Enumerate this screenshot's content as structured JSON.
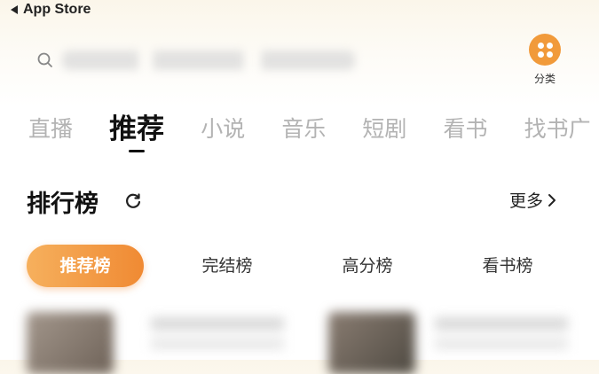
{
  "status_bar": {
    "back_label": "App Store"
  },
  "search": {
    "placeholder": ""
  },
  "category_button": {
    "label": "分类",
    "icon": "four-dots-icon",
    "color": "#f19a3a"
  },
  "tabs": [
    {
      "label": "直播",
      "active": false
    },
    {
      "label": "推荐",
      "active": true
    },
    {
      "label": "小说",
      "active": false
    },
    {
      "label": "音乐",
      "active": false
    },
    {
      "label": "短剧",
      "active": false
    },
    {
      "label": "看书",
      "active": false
    },
    {
      "label": "找书广",
      "active": false
    }
  ],
  "ranking": {
    "title": "排行榜",
    "more_label": "更多",
    "tabs": [
      {
        "label": "推荐榜",
        "active": true
      },
      {
        "label": "完结榜",
        "active": false
      },
      {
        "label": "高分榜",
        "active": false
      },
      {
        "label": "看书榜",
        "active": false
      }
    ]
  },
  "colors": {
    "accent_start": "#f6b05d",
    "accent_end": "#f08a33"
  }
}
